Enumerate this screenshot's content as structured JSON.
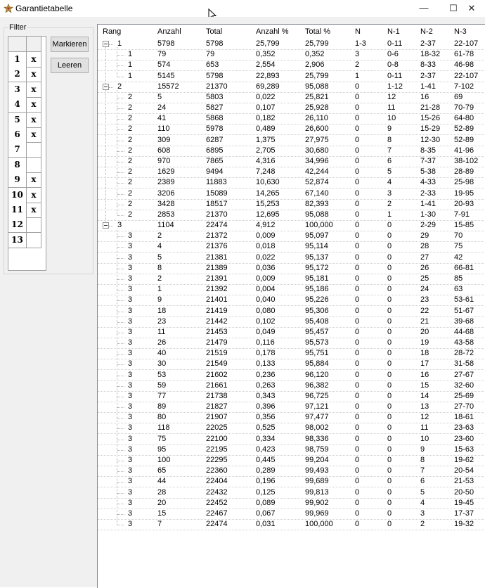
{
  "window": {
    "title": "Garantietabelle",
    "minimize_glyph": "—",
    "maximize_glyph": "☐",
    "close_glyph": "✕",
    "icon": "garantie-app-icon"
  },
  "filter": {
    "caption": "Filter",
    "rows": [
      {
        "num": "1",
        "mark": "x"
      },
      {
        "num": "2",
        "mark": "x"
      },
      {
        "num": "3",
        "mark": "x"
      },
      {
        "num": "4",
        "mark": "x"
      },
      {
        "num": "5",
        "mark": "x"
      },
      {
        "num": "6",
        "mark": "x"
      },
      {
        "num": "7",
        "mark": ""
      },
      {
        "num": "8",
        "mark": ""
      },
      {
        "num": "9",
        "mark": "x"
      },
      {
        "num": "10",
        "mark": "x"
      },
      {
        "num": "11",
        "mark": "x"
      },
      {
        "num": "12",
        "mark": ""
      },
      {
        "num": "13",
        "mark": ""
      }
    ],
    "mark_button": "Markieren",
    "clear_button": "Leeren"
  },
  "table": {
    "headers": [
      "Rang",
      "Anzahl",
      "Total",
      "Anzahl %",
      "Total %",
      "N",
      "N-1",
      "N-2",
      "N-3"
    ],
    "rows": [
      {
        "level": 0,
        "rang": "1",
        "cells": [
          "5798",
          "5798",
          "25,799",
          "25,799",
          "1-3",
          "0-11",
          "2-37",
          "22-107"
        ]
      },
      {
        "level": 1,
        "rang": "1",
        "cells": [
          "79",
          "79",
          "0,352",
          "0,352",
          "3",
          "0-6",
          "18-32",
          "61-78"
        ]
      },
      {
        "level": 1,
        "rang": "1",
        "cells": [
          "574",
          "653",
          "2,554",
          "2,906",
          "2",
          "0-8",
          "8-33",
          "46-98"
        ]
      },
      {
        "level": 1,
        "rang": "1",
        "cells": [
          "5145",
          "5798",
          "22,893",
          "25,799",
          "1",
          "0-11",
          "2-37",
          "22-107"
        ]
      },
      {
        "level": 0,
        "rang": "2",
        "cells": [
          "15572",
          "21370",
          "69,289",
          "95,088",
          "0",
          "1-12",
          "1-41",
          "7-102"
        ]
      },
      {
        "level": 1,
        "rang": "2",
        "cells": [
          "5",
          "5803",
          "0,022",
          "25,821",
          "0",
          "12",
          "16",
          "69"
        ]
      },
      {
        "level": 1,
        "rang": "2",
        "cells": [
          "24",
          "5827",
          "0,107",
          "25,928",
          "0",
          "11",
          "21-28",
          "70-79"
        ]
      },
      {
        "level": 1,
        "rang": "2",
        "cells": [
          "41",
          "5868",
          "0,182",
          "26,110",
          "0",
          "10",
          "15-26",
          "64-80"
        ]
      },
      {
        "level": 1,
        "rang": "2",
        "cells": [
          "110",
          "5978",
          "0,489",
          "26,600",
          "0",
          "9",
          "15-29",
          "52-89"
        ]
      },
      {
        "level": 1,
        "rang": "2",
        "cells": [
          "309",
          "6287",
          "1,375",
          "27,975",
          "0",
          "8",
          "12-30",
          "52-89"
        ]
      },
      {
        "level": 1,
        "rang": "2",
        "cells": [
          "608",
          "6895",
          "2,705",
          "30,680",
          "0",
          "7",
          "8-35",
          "41-96"
        ]
      },
      {
        "level": 1,
        "rang": "2",
        "cells": [
          "970",
          "7865",
          "4,316",
          "34,996",
          "0",
          "6",
          "7-37",
          "38-102"
        ]
      },
      {
        "level": 1,
        "rang": "2",
        "cells": [
          "1629",
          "9494",
          "7,248",
          "42,244",
          "0",
          "5",
          "5-38",
          "28-89"
        ]
      },
      {
        "level": 1,
        "rang": "2",
        "cells": [
          "2389",
          "11883",
          "10,630",
          "52,874",
          "0",
          "4",
          "4-33",
          "25-98"
        ]
      },
      {
        "level": 1,
        "rang": "2",
        "cells": [
          "3206",
          "15089",
          "14,265",
          "67,140",
          "0",
          "3",
          "2-33",
          "19-95"
        ]
      },
      {
        "level": 1,
        "rang": "2",
        "cells": [
          "3428",
          "18517",
          "15,253",
          "82,393",
          "0",
          "2",
          "1-41",
          "20-93"
        ]
      },
      {
        "level": 1,
        "rang": "2",
        "cells": [
          "2853",
          "21370",
          "12,695",
          "95,088",
          "0",
          "1",
          "1-30",
          "7-91"
        ]
      },
      {
        "level": 0,
        "rang": "3",
        "cells": [
          "1104",
          "22474",
          "4,912",
          "100,000",
          "0",
          "0",
          "2-29",
          "15-85"
        ]
      },
      {
        "level": 1,
        "rang": "3",
        "cells": [
          "2",
          "21372",
          "0,009",
          "95,097",
          "0",
          "0",
          "29",
          "70"
        ]
      },
      {
        "level": 1,
        "rang": "3",
        "cells": [
          "4",
          "21376",
          "0,018",
          "95,114",
          "0",
          "0",
          "28",
          "75"
        ]
      },
      {
        "level": 1,
        "rang": "3",
        "cells": [
          "5",
          "21381",
          "0,022",
          "95,137",
          "0",
          "0",
          "27",
          "42"
        ]
      },
      {
        "level": 1,
        "rang": "3",
        "cells": [
          "8",
          "21389",
          "0,036",
          "95,172",
          "0",
          "0",
          "26",
          "66-81"
        ]
      },
      {
        "level": 1,
        "rang": "3",
        "cells": [
          "2",
          "21391",
          "0,009",
          "95,181",
          "0",
          "0",
          "25",
          "85"
        ]
      },
      {
        "level": 1,
        "rang": "3",
        "cells": [
          "1",
          "21392",
          "0,004",
          "95,186",
          "0",
          "0",
          "24",
          "63"
        ]
      },
      {
        "level": 1,
        "rang": "3",
        "cells": [
          "9",
          "21401",
          "0,040",
          "95,226",
          "0",
          "0",
          "23",
          "53-61"
        ]
      },
      {
        "level": 1,
        "rang": "3",
        "cells": [
          "18",
          "21419",
          "0,080",
          "95,306",
          "0",
          "0",
          "22",
          "51-67"
        ]
      },
      {
        "level": 1,
        "rang": "3",
        "cells": [
          "23",
          "21442",
          "0,102",
          "95,408",
          "0",
          "0",
          "21",
          "39-68"
        ]
      },
      {
        "level": 1,
        "rang": "3",
        "cells": [
          "11",
          "21453",
          "0,049",
          "95,457",
          "0",
          "0",
          "20",
          "44-68"
        ]
      },
      {
        "level": 1,
        "rang": "3",
        "cells": [
          "26",
          "21479",
          "0,116",
          "95,573",
          "0",
          "0",
          "19",
          "43-58"
        ]
      },
      {
        "level": 1,
        "rang": "3",
        "cells": [
          "40",
          "21519",
          "0,178",
          "95,751",
          "0",
          "0",
          "18",
          "28-72"
        ]
      },
      {
        "level": 1,
        "rang": "3",
        "cells": [
          "30",
          "21549",
          "0,133",
          "95,884",
          "0",
          "0",
          "17",
          "31-58"
        ]
      },
      {
        "level": 1,
        "rang": "3",
        "cells": [
          "53",
          "21602",
          "0,236",
          "96,120",
          "0",
          "0",
          "16",
          "27-67"
        ]
      },
      {
        "level": 1,
        "rang": "3",
        "cells": [
          "59",
          "21661",
          "0,263",
          "96,382",
          "0",
          "0",
          "15",
          "32-60"
        ]
      },
      {
        "level": 1,
        "rang": "3",
        "cells": [
          "77",
          "21738",
          "0,343",
          "96,725",
          "0",
          "0",
          "14",
          "25-69"
        ]
      },
      {
        "level": 1,
        "rang": "3",
        "cells": [
          "89",
          "21827",
          "0,396",
          "97,121",
          "0",
          "0",
          "13",
          "27-70"
        ]
      },
      {
        "level": 1,
        "rang": "3",
        "cells": [
          "80",
          "21907",
          "0,356",
          "97,477",
          "0",
          "0",
          "12",
          "18-61"
        ]
      },
      {
        "level": 1,
        "rang": "3",
        "cells": [
          "118",
          "22025",
          "0,525",
          "98,002",
          "0",
          "0",
          "11",
          "23-63"
        ]
      },
      {
        "level": 1,
        "rang": "3",
        "cells": [
          "75",
          "22100",
          "0,334",
          "98,336",
          "0",
          "0",
          "10",
          "23-60"
        ]
      },
      {
        "level": 1,
        "rang": "3",
        "cells": [
          "95",
          "22195",
          "0,423",
          "98,759",
          "0",
          "0",
          "9",
          "15-63"
        ]
      },
      {
        "level": 1,
        "rang": "3",
        "cells": [
          "100",
          "22295",
          "0,445",
          "99,204",
          "0",
          "0",
          "8",
          "19-62"
        ]
      },
      {
        "level": 1,
        "rang": "3",
        "cells": [
          "65",
          "22360",
          "0,289",
          "99,493",
          "0",
          "0",
          "7",
          "20-54"
        ]
      },
      {
        "level": 1,
        "rang": "3",
        "cells": [
          "44",
          "22404",
          "0,196",
          "99,689",
          "0",
          "0",
          "6",
          "21-53"
        ]
      },
      {
        "level": 1,
        "rang": "3",
        "cells": [
          "28",
          "22432",
          "0,125",
          "99,813",
          "0",
          "0",
          "5",
          "20-50"
        ]
      },
      {
        "level": 1,
        "rang": "3",
        "cells": [
          "20",
          "22452",
          "0,089",
          "99,902",
          "0",
          "0",
          "4",
          "19-45"
        ]
      },
      {
        "level": 1,
        "rang": "3",
        "cells": [
          "15",
          "22467",
          "0,067",
          "99,969",
          "0",
          "0",
          "3",
          "17-37"
        ]
      },
      {
        "level": 1,
        "rang": "3",
        "cells": [
          "7",
          "22474",
          "0,031",
          "100,000",
          "0",
          "0",
          "2",
          "19-32"
        ]
      }
    ]
  }
}
